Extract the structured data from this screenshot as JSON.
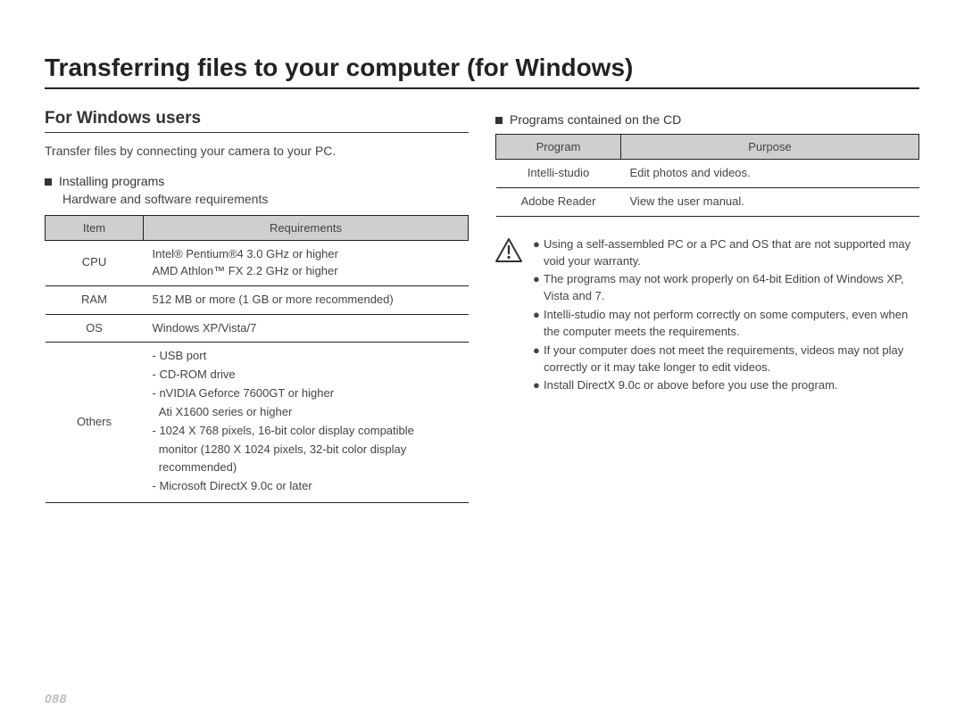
{
  "page_title": "Transferring files to your computer (for Windows)",
  "page_number": "088",
  "left": {
    "subheading": "For Windows users",
    "intro": "Transfer files by connecting your camera to your PC.",
    "installing_label": "Installing programs",
    "requirements_sub": "Hardware and software requirements",
    "req_table": {
      "header": {
        "item": "Item",
        "req": "Requirements"
      },
      "rows": [
        {
          "item": "CPU",
          "req_lines": [
            "Intel® Pentium®4 3.0 GHz or higher",
            "AMD Athlon™ FX 2.2 GHz or higher"
          ]
        },
        {
          "item": "RAM",
          "req_lines": [
            "512 MB or more (1 GB or more recommended)"
          ]
        },
        {
          "item": "OS",
          "req_lines": [
            "Windows XP/Vista/7"
          ]
        },
        {
          "item": "Others",
          "req_lines": [
            "- USB port",
            "- CD-ROM drive",
            "- nVIDIA Geforce 7600GT or higher",
            "  Ati X1600 series or higher",
            "- 1024 X 768 pixels, 16-bit color display compatible",
            "  monitor (1280 X 1024 pixels, 32-bit color display",
            "  recommended)",
            "- Microsoft DirectX 9.0c or later"
          ]
        }
      ]
    }
  },
  "right": {
    "programs_label": "Programs contained on the CD",
    "prog_table": {
      "header": {
        "program": "Program",
        "purpose": "Purpose"
      },
      "rows": [
        {
          "program": "Intelli-studio",
          "purpose": "Edit photos and videos."
        },
        {
          "program": "Adobe Reader",
          "purpose": "View the user manual."
        }
      ]
    },
    "warnings": [
      "Using a self-assembled PC or a PC and OS that are not supported may void your warranty.",
      "The programs may not work properly on 64-bit Edition of Windows XP, Vista and 7.",
      "Intelli-studio may not perform correctly on some computers, even when the computer meets the requirements.",
      "If your computer does not meet the requirements, videos may not play correctly or it may take longer to edit videos.",
      "Install DirectX 9.0c or above before you use the program."
    ]
  }
}
